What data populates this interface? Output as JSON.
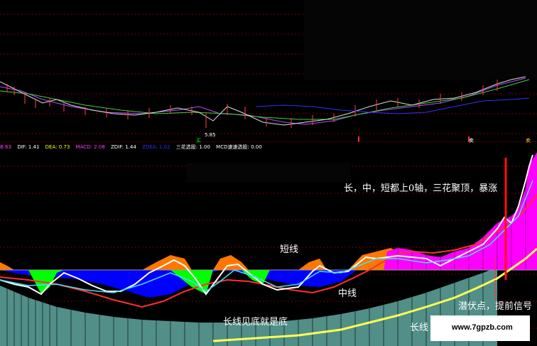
{
  "indicators": {
    "first_value": "B:63",
    "dif": "DIF: 1.41",
    "dea": "DEA: 0.73",
    "macd": "MACD: 2.08",
    "zdif": "ZDIF: 1.44",
    "zdea": "ZDEA: 1.02",
    "sanhua": "三花选股: 1.00",
    "mcd": "MCD速速选股: 0.00"
  },
  "price_chart": {
    "low_label": "5.85",
    "buy_tag": "买",
    "sell_tag_1": "卖",
    "sell_tag_2": "卖"
  },
  "annotations": {
    "headline": "长，中，短都上0轴，三花聚顶，暴涨",
    "short_line": "短线",
    "mid_line": "中线",
    "long_line": "长线",
    "long_bottom": "长线见底就是底",
    "latent_point": "潜伏点，提前信号",
    "watermark": "www.7gpzb.com"
  },
  "colors": {
    "background": "#000000",
    "grid": "#7a0000",
    "short_fill": "#ff7700",
    "magenta_fill": "#ff00ff",
    "green_fill": "#00ff00",
    "blue_fill": "#0000ff",
    "long_bars": "#5fa8a0",
    "long_line": "#ffff55",
    "mid_line": "#ff3030",
    "short_line": "#ffffff",
    "signal_line": "#ff0000"
  }
}
